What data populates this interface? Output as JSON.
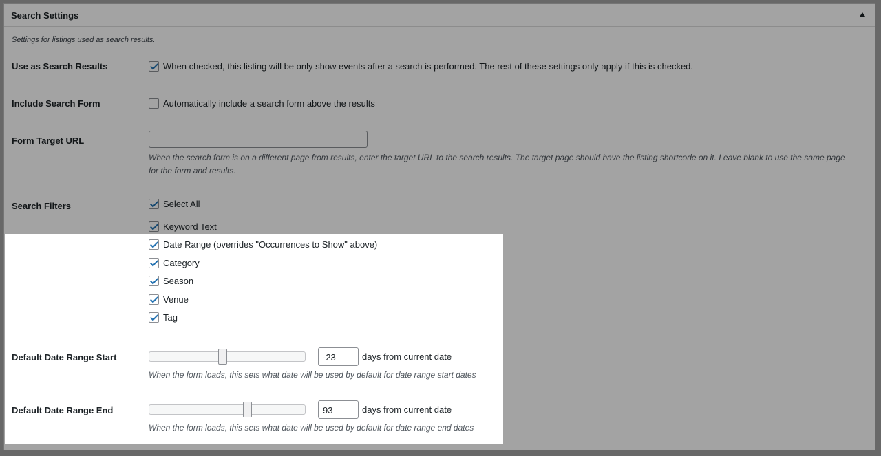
{
  "panel": {
    "title": "Search Settings",
    "description": "Settings for listings used as search results."
  },
  "use_search_results": {
    "label": "Use as Search Results",
    "checked": true,
    "text": "When checked, this listing will be only show events after a search is performed. The rest of these settings only apply if this is checked."
  },
  "include_search_form": {
    "label": "Include Search Form",
    "checked": false,
    "text": "Automatically include a search form above the results"
  },
  "form_target_url": {
    "label": "Form Target URL",
    "value": "",
    "help_line1": "When the search form is on a different page from results, enter the target URL to the search results. The target page should have the listing shortcode on it. Leave blank to use the same page",
    "help_line2": "for the form and results."
  },
  "search_filters": {
    "label": "Search Filters",
    "items": [
      {
        "label": "Select All",
        "checked": true
      },
      {
        "label": "Keyword Text",
        "checked": true
      },
      {
        "label": "Date Range (overrides \"Occurrences to Show\" above)",
        "checked": true
      },
      {
        "label": "Category",
        "checked": true
      },
      {
        "label": "Season",
        "checked": true
      },
      {
        "label": "Venue",
        "checked": true
      },
      {
        "label": "Tag",
        "checked": true
      }
    ]
  },
  "date_range_start": {
    "label": "Default Date Range Start",
    "value": "-23",
    "suffix": "days from current date",
    "help": "When the form loads, this sets what date will be used by default for date range start dates"
  },
  "date_range_end": {
    "label": "Default Date Range End",
    "value": "93",
    "suffix": "days from current date",
    "help": "When the form loads, this sets what date will be used by default for date range end dates"
  },
  "icons": {
    "collapse": "triangle-up-icon",
    "checkbox": "checkmark-icon"
  }
}
